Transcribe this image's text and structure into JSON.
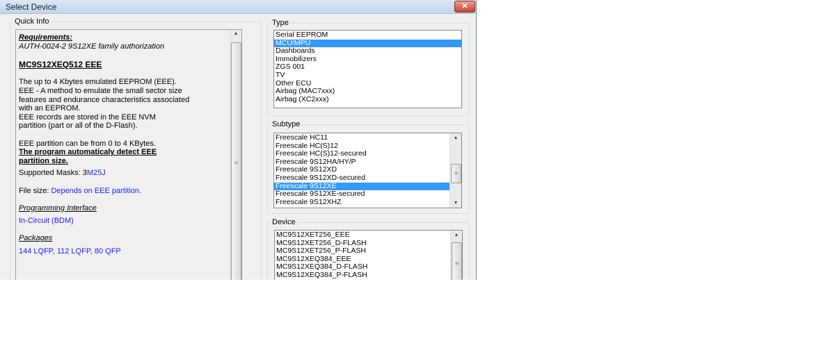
{
  "window": {
    "title": "Select Device",
    "close": "✕"
  },
  "quick_info": {
    "label": "Quick Info",
    "requirements_heading": "Requirements:",
    "requirements": "AUTH-0024-2  9S12XE family authorization",
    "device_heading": "MC9S12XEQ512 EEE",
    "desc": [
      "The up to 4 Kbytes emulated EEPROM (EEE).",
      "EEE - A method to emulate the small sector size",
      "features and endurance characteristics associated",
      "with an EEPROM.",
      "EEE records are stored in the EEE NVM",
      "partition (part or all of the D-Flash)."
    ],
    "partition": "EEE partition can be from 0 to 4 KBytes.",
    "auto_detect": [
      "The program automaticaly detect EEE",
      "partition size."
    ],
    "masks_label": "Supported Masks: ",
    "masks_prefix": "3",
    "masks_value": "M25J",
    "filesize_label": "File size: ",
    "filesize_value": "Depends on EEE partition.",
    "interface_heading": "Programming Interface",
    "interface_value": "In-Circuit (BDM)",
    "packages_heading": "Packages",
    "packages_value": "144 LQFP, 112 LQFP,  80 QFP"
  },
  "type": {
    "label": "Type",
    "items": [
      "Serial EEPROM",
      "MCU/MPU",
      "Dashboards",
      "Immobilizers",
      "ZGS 001",
      "TV",
      "Other ECU",
      "Airbag (MAC7xxx)",
      "Airbag (XC2xxx)"
    ],
    "selected": 1
  },
  "subtype": {
    "label": "Subtype",
    "items": [
      "Freescale HC11",
      "Freescale HC(S)12",
      "Freescale HC(S)12-secured",
      "Freescale 9S12HA/HY/P",
      "Freescale 9S12XD",
      "Freescale 9S12XD-secured",
      "Freescale 9S12XE",
      "Freescale 9S12XE-secured",
      "Freescale 9S12XHZ"
    ],
    "selected": 6
  },
  "device": {
    "label": "Device",
    "items": [
      "MC9S12XET256_EEE",
      "MC9S12XET256_D-FLASH",
      "MC9S12XET256_P-FLASH",
      "MC9S12XEQ384_EEE",
      "MC9S12XEQ384_D-FLASH",
      "MC9S12XEQ384_P-FLASH"
    ]
  },
  "colors": {
    "selection": "#3399ff",
    "link": "#1a1aff",
    "close": "#c8452f"
  }
}
